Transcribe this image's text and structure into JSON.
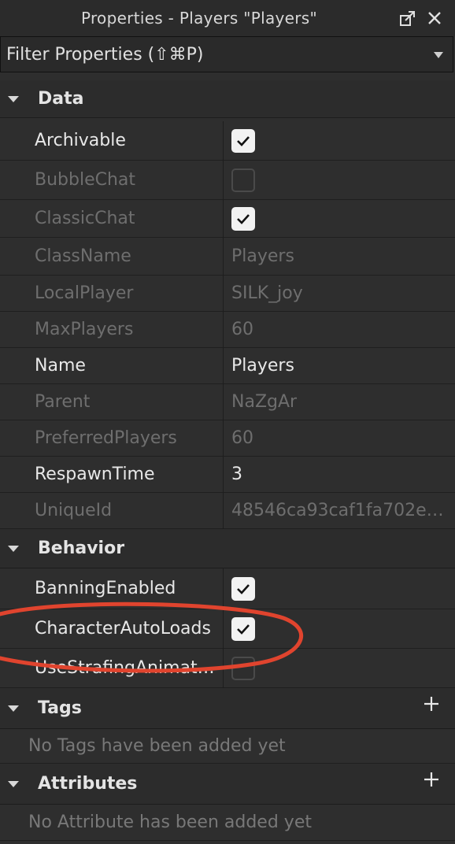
{
  "window": {
    "title": "Properties - Players \"Players\"",
    "icons": [
      "undock-icon",
      "close-icon"
    ]
  },
  "filter": {
    "placeholder": "Filter Properties (⇧⌘P)"
  },
  "sections": {
    "data": {
      "title": "Data",
      "rows": [
        {
          "name": "Archivable",
          "type": "checkbox",
          "checked": true,
          "enabled": true
        },
        {
          "name": "BubbleChat",
          "type": "checkbox",
          "checked": false,
          "enabled": false
        },
        {
          "name": "ClassicChat",
          "type": "checkbox",
          "checked": true,
          "enabled": false
        },
        {
          "name": "ClassName",
          "type": "text",
          "value": "Players",
          "enabled": false
        },
        {
          "name": "LocalPlayer",
          "type": "text",
          "value": "SILK_joy",
          "enabled": false
        },
        {
          "name": "MaxPlayers",
          "type": "text",
          "value": "60",
          "enabled": false
        },
        {
          "name": "Name",
          "type": "text",
          "value": "Players",
          "enabled": true
        },
        {
          "name": "Parent",
          "type": "text",
          "value": "NaZgAr",
          "enabled": false
        },
        {
          "name": "PreferredPlayers",
          "type": "text",
          "value": "60",
          "enabled": false
        },
        {
          "name": "RespawnTime",
          "type": "text",
          "value": "3",
          "enabled": true
        },
        {
          "name": "UniqueId",
          "type": "text",
          "value": "48546ca93caf1fa702e9…",
          "enabled": false
        }
      ]
    },
    "behavior": {
      "title": "Behavior",
      "rows": [
        {
          "name": "BanningEnabled",
          "type": "checkbox",
          "checked": true,
          "enabled": true
        },
        {
          "name": "CharacterAutoLoads",
          "type": "checkbox",
          "checked": true,
          "enabled": true
        },
        {
          "name": "UseStrafingAnimat…",
          "type": "checkbox",
          "checked": false,
          "enabled": true
        }
      ]
    },
    "tags": {
      "title": "Tags",
      "empty_text": "No Tags have been added yet"
    },
    "attributes": {
      "title": "Attributes",
      "empty_text": "No Attribute has been added yet"
    }
  },
  "colors": {
    "background": "#2e2e2e",
    "annotation_circle": "#e0442e"
  }
}
